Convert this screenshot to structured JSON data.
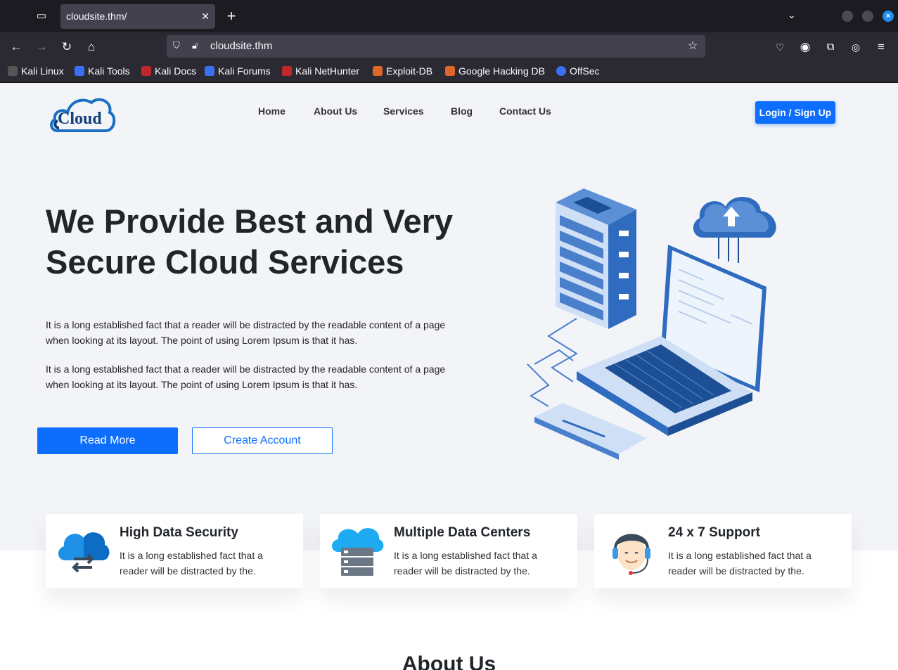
{
  "browser": {
    "tab_title": "cloudsite.thm/",
    "close_tab_glyph": "✕",
    "new_tab_glyph": "+",
    "url": "cloudsite.thm",
    "bookmarks": [
      "Kali Linux",
      "Kali Tools",
      "Kali Docs",
      "Kali Forums",
      "Kali NetHunter",
      "Exploit-DB",
      "Google Hacking DB",
      "OffSec"
    ]
  },
  "site": {
    "logo_text": "Cloud",
    "menu": [
      "Home",
      "About Us",
      "Services",
      "Blog",
      "Contact Us"
    ],
    "login_label": "Login / Sign Up",
    "hero_title": "We Provide Best and Very Secure Cloud Services",
    "hero_paragraph_1": "It is a long established fact that a reader will be distracted by the readable content of a page when looking at its layout. The point of using Lorem Ipsum is that it has.",
    "hero_paragraph_2": "It is a long established fact that a reader will be distracted by the readable content of a page when looking at its layout. The point of using Lorem Ipsum is that it has.",
    "read_more_label": "Read More",
    "create_account_label": "Create Account",
    "features": [
      {
        "title": "High Data Security",
        "text": "It is a long established fact that a reader will be distracted by the.",
        "icon": "cloud-transfer-icon"
      },
      {
        "title": "Multiple Data Centers",
        "text": "It is a long established fact that a reader will be distracted by the.",
        "icon": "cloud-server-icon"
      },
      {
        "title": "24 x 7 Support",
        "text": "It is a long established fact that a reader will be distracted by the.",
        "icon": "support-agent-icon"
      }
    ],
    "about_heading": "About Us"
  },
  "colors": {
    "primary": "#0d6efd",
    "page_bg": "#f3f4f8",
    "chrome_dark": "#1c1b22"
  }
}
